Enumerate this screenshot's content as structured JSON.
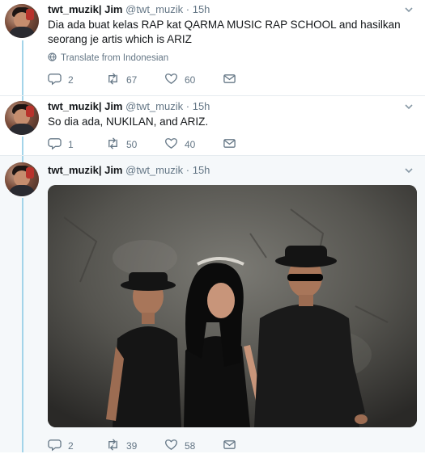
{
  "tweets": [
    {
      "display_name": "twt_muzik| Jim",
      "handle": "@twt_muzik",
      "separator": "·",
      "time": "15h",
      "text": "Dia ada buat kelas RAP kat QARMA MUSIC RAP SCHOOL and hasilkan seorang je artis which is ARIZ",
      "translate_label": "Translate from Indonesian",
      "replies": "2",
      "retweets": "67",
      "likes": "60"
    },
    {
      "display_name": "twt_muzik| Jim",
      "handle": "@twt_muzik",
      "separator": "·",
      "time": "15h",
      "text": "So dia ada, NUKILAN, and ARIZ.",
      "replies": "1",
      "retweets": "50",
      "likes": "40"
    },
    {
      "display_name": "twt_muzik| Jim",
      "handle": "@twt_muzik",
      "separator": "·",
      "time": "15h",
      "replies": "2",
      "retweets": "39",
      "likes": "58"
    }
  ],
  "icons": {
    "reply": "reply-icon",
    "retweet": "retweet-icon",
    "like": "heart-icon",
    "dm": "direct-message-icon",
    "globe": "globe-icon",
    "caret": "chevron-down-icon"
  },
  "colors": {
    "thread_line": "#a3d4e9",
    "meta_text": "#657786",
    "highlight_bg": "#f5f8fa"
  }
}
